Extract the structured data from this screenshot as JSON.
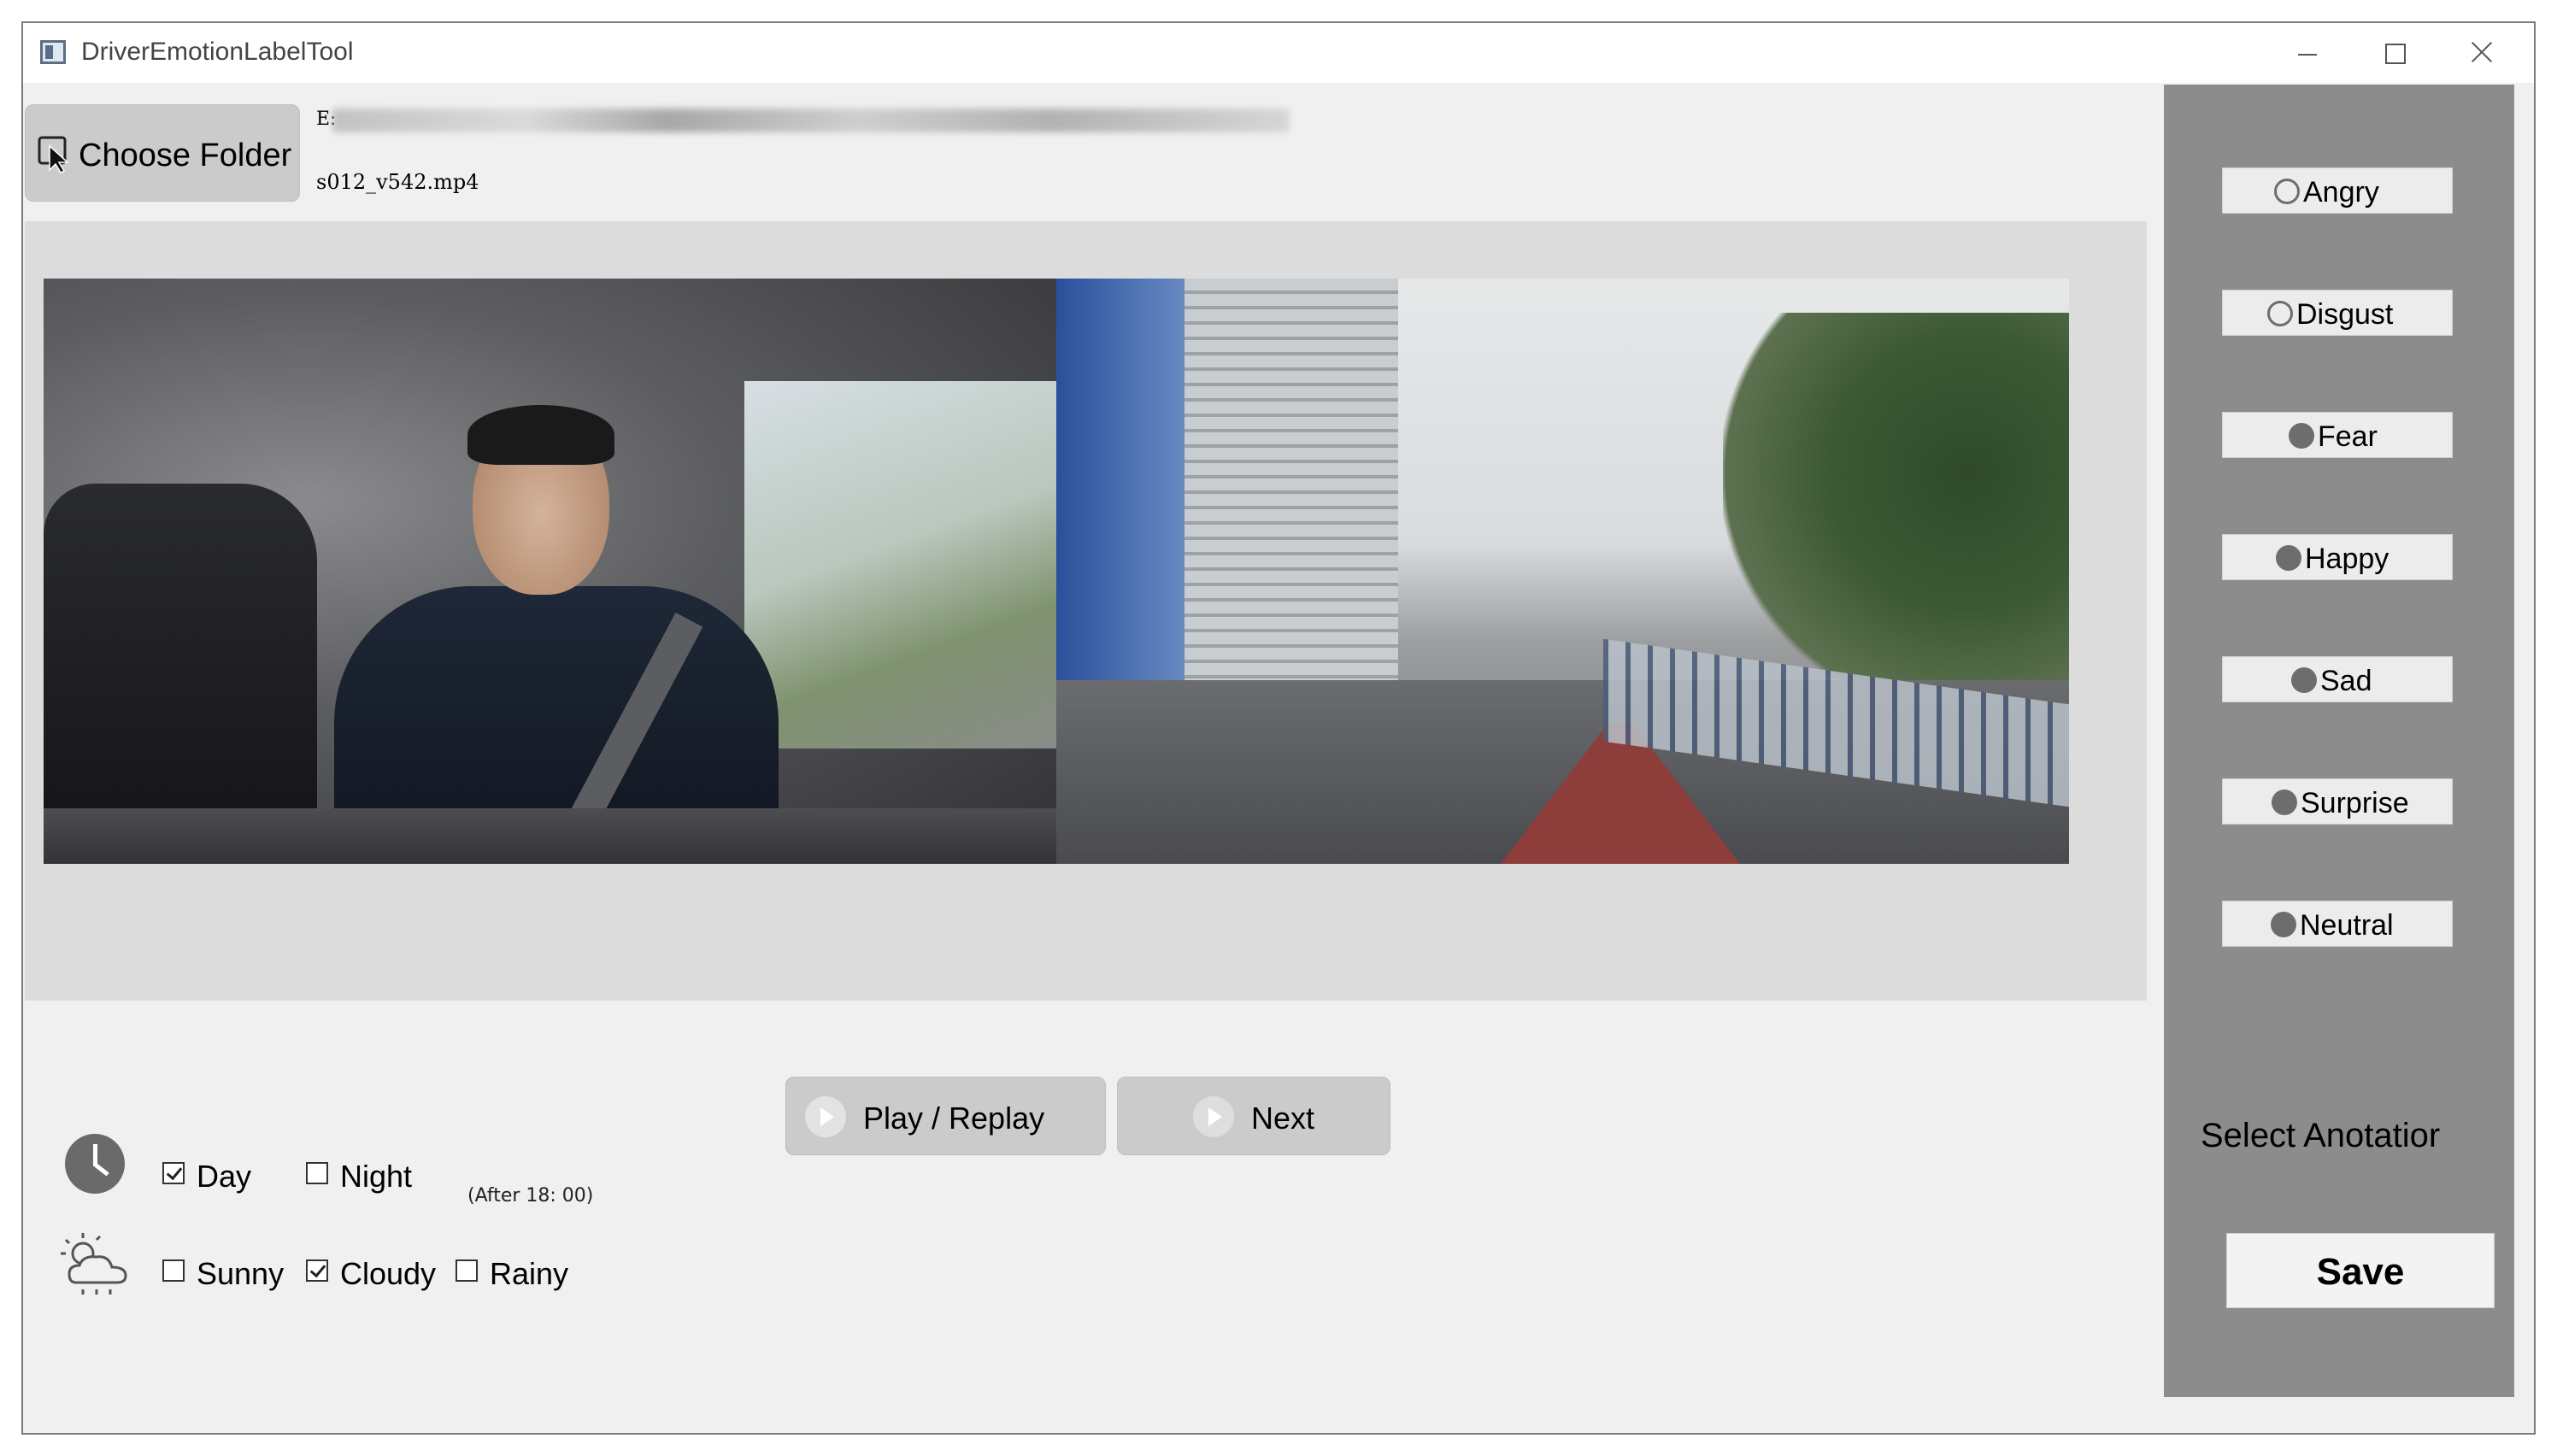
{
  "window": {
    "title": "DriverEmotionLabelTool"
  },
  "toolbar": {
    "choose_folder_label": "Choose Folder",
    "path_prefix": "E:",
    "file_name": "s012_v542.mp4"
  },
  "controls": {
    "play_label": "Play / Replay",
    "next_label": "Next"
  },
  "time_of_day": {
    "options": [
      {
        "label": "Day",
        "checked": true
      },
      {
        "label": "Night",
        "checked": false
      }
    ],
    "hint": "(After 18: 00)"
  },
  "weather": {
    "options": [
      {
        "label": "Sunny",
        "checked": false
      },
      {
        "label": "Cloudy",
        "checked": true
      },
      {
        "label": "Rainy",
        "checked": false
      }
    ]
  },
  "emotions": [
    {
      "label": "Angry",
      "icon": "angry-face-icon"
    },
    {
      "label": "Disgust",
      "icon": "disgust-face-icon"
    },
    {
      "label": "Fear",
      "icon": "fear-face-icon"
    },
    {
      "label": "Happy",
      "icon": "happy-face-icon"
    },
    {
      "label": "Sad",
      "icon": "sad-face-icon"
    },
    {
      "label": "Surprise",
      "icon": "surprise-face-icon"
    },
    {
      "label": "Neutral",
      "icon": "neutral-face-icon"
    }
  ],
  "annotation": {
    "select_label": "Select Anotatior"
  },
  "save": {
    "label": "Save"
  },
  "colors": {
    "panel_bg": "#8c8c8c",
    "button_bg": "#cbcbcb",
    "window_bg": "#f0f0f0"
  }
}
